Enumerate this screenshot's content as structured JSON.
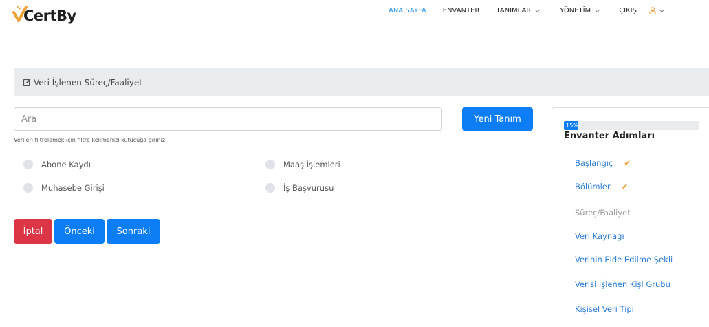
{
  "brand": {
    "name": "CertBy"
  },
  "nav": {
    "items": [
      {
        "label": "ANA SAYFA",
        "active": true,
        "dropdown": false
      },
      {
        "label": "ENVANTER",
        "active": false,
        "dropdown": false
      },
      {
        "label": "TANIMLAR",
        "active": false,
        "dropdown": true
      },
      {
        "label": "YÖNETİM",
        "active": false,
        "dropdown": true
      },
      {
        "label": "ÇIKIŞ",
        "active": false,
        "dropdown": false
      }
    ],
    "user_icon": "user-icon"
  },
  "section": {
    "title": "Veri İşlenen Süreç/Faaliyet",
    "icon": "edit-icon"
  },
  "search": {
    "placeholder": "Ara",
    "value": "",
    "help": "Verileri filtrelemek için filtre kelimenizi kutucuğa giriniz."
  },
  "new_button": "Yeni Tanım",
  "radios": [
    {
      "label": "Abone Kaydı"
    },
    {
      "label": "Maaş İşlemleri"
    },
    {
      "label": "Muhasebe Girişi"
    },
    {
      "label": "İş Başvurusu"
    }
  ],
  "actions": {
    "cancel": "İptal",
    "previous": "Önceki",
    "next": "Sonraki"
  },
  "steps": {
    "progress_label": "15%",
    "progress_value": 0.1,
    "title": "Envanter Adımları",
    "items": [
      {
        "label": "Başlangıç",
        "done": true
      },
      {
        "label": "Bölümler",
        "done": true
      },
      {
        "label": "Süreç/Faaliyet",
        "current": true
      },
      {
        "label": "Veri Kaynağı"
      },
      {
        "label": "Verinin Elde Edilme Şekli"
      },
      {
        "label": "Verisi İşlenen Kişi Grubu"
      },
      {
        "label": "Kişisel Veri Tipi"
      }
    ]
  },
  "colors": {
    "primary": "#0d7df5",
    "danger": "#dc3545",
    "accent": "#f0a23a",
    "link": "#2b7bd8"
  }
}
